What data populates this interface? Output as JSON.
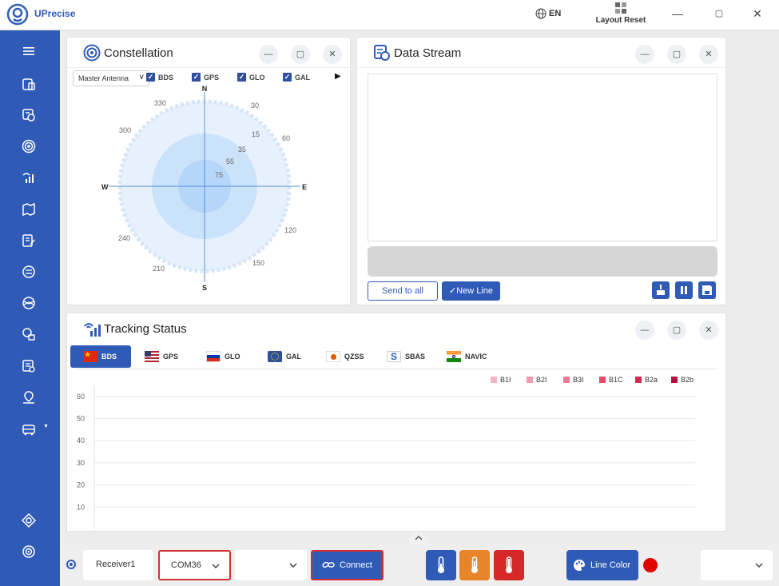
{
  "app": {
    "title": "UPrecise",
    "language": "EN",
    "layout_reset": "Layout Reset"
  },
  "window_controls": {
    "minimize": "—",
    "maximize": "▢",
    "close": "✕"
  },
  "sidebar": {
    "items": [
      {
        "icon": "menu-icon"
      },
      {
        "icon": "device-icon"
      },
      {
        "icon": "data-stream-icon"
      },
      {
        "icon": "constellation-icon"
      },
      {
        "icon": "tracking-icon"
      },
      {
        "icon": "map-icon"
      },
      {
        "icon": "log-icon"
      },
      {
        "icon": "settings-icon"
      },
      {
        "icon": "globe-icon"
      },
      {
        "icon": "network-icon"
      },
      {
        "icon": "report-icon"
      },
      {
        "icon": "location-icon"
      },
      {
        "icon": "vehicle-icon"
      },
      {
        "icon": "satellite-icon"
      },
      {
        "icon": "sync-icon"
      }
    ]
  },
  "constellation": {
    "title": "Constellation",
    "antenna": "Master Antenna",
    "systems": [
      "BDS",
      "GPS",
      "GLO",
      "GAL"
    ],
    "compass": {
      "north": "N",
      "south": "S",
      "east": "E",
      "west": "W"
    },
    "azimuth_labels": [
      "30",
      "60",
      "120",
      "150",
      "210",
      "240",
      "300",
      "330"
    ],
    "elevation_labels": [
      "15",
      "35",
      "55",
      "75"
    ]
  },
  "data_stream": {
    "title": "Data Stream",
    "send_all": "Send to all",
    "new_line": "✓New Line"
  },
  "tracking": {
    "title": "Tracking Status",
    "tabs": [
      "BDS",
      "GPS",
      "GLO",
      "GAL",
      "QZSS",
      "SBAS",
      "NAVIC"
    ],
    "active_tab": "BDS",
    "legend": [
      {
        "name": "B1I",
        "color": "#f6b3c2"
      },
      {
        "name": "B2I",
        "color": "#f39aae"
      },
      {
        "name": "B3I",
        "color": "#ee7890"
      },
      {
        "name": "B1C",
        "color": "#e44a6a"
      },
      {
        "name": "B2a",
        "color": "#d42a4e"
      },
      {
        "name": "B2b",
        "color": "#b8103a"
      }
    ],
    "y_ticks": [
      "60",
      "50",
      "40",
      "30",
      "20",
      "10"
    ]
  },
  "chart_data": {
    "type": "bar",
    "categories": [],
    "series": [
      {
        "name": "B1I",
        "values": []
      },
      {
        "name": "B2I",
        "values": []
      },
      {
        "name": "B3I",
        "values": []
      },
      {
        "name": "B1C",
        "values": []
      },
      {
        "name": "B2a",
        "values": []
      },
      {
        "name": "B2b",
        "values": []
      }
    ],
    "ylim": [
      0,
      65
    ],
    "grid": true,
    "legend": "top-right"
  },
  "bottom": {
    "receiver": "Receiver1",
    "port": "COM36",
    "baud": "",
    "connect": "Connect",
    "line_color": "Line Color",
    "temperature_colors": [
      "#2f5bb7",
      "#e8852a",
      "#d62828"
    ],
    "line_color_swatch": "#e00000"
  }
}
